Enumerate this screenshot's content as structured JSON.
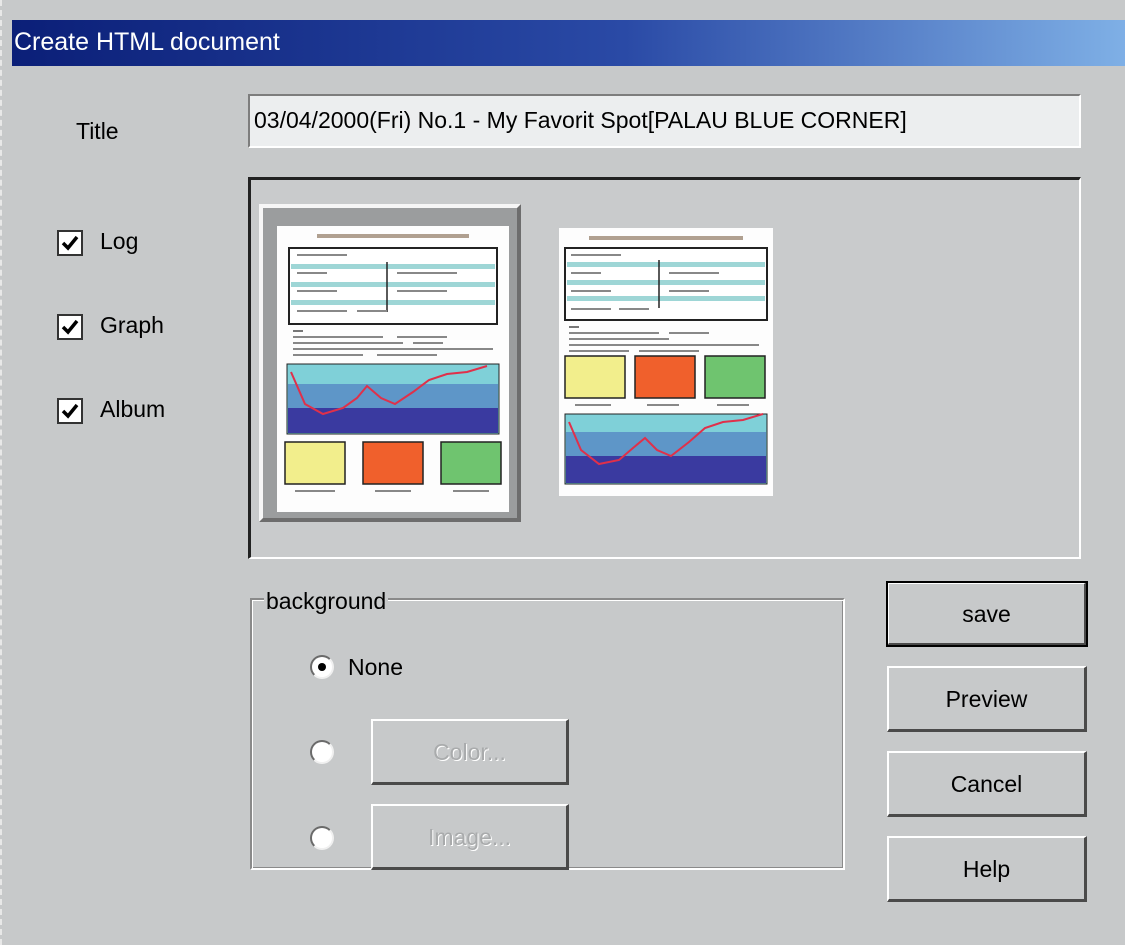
{
  "window": {
    "title": "Create HTML document"
  },
  "form": {
    "title_label": "Title",
    "title_value": "03/04/2000(Fri) No.1 - My Favorit Spot[PALAU BLUE CORNER]"
  },
  "checkboxes": [
    {
      "label": "Log",
      "checked": true
    },
    {
      "label": "Graph",
      "checked": true
    },
    {
      "label": "Album",
      "checked": true
    }
  ],
  "layouts": {
    "selected_index": 0,
    "colors": {
      "yellow": "#f2ee8c",
      "orange": "#f0602c",
      "green": "#6fc46f",
      "graph_top": "#7fd0d8",
      "graph_bottom": "#3a3aa0",
      "line": "#e0304a"
    }
  },
  "background": {
    "group_label": "background",
    "options": [
      {
        "label": "None",
        "selected": true
      },
      {
        "button": "Color...",
        "selected": false,
        "enabled": false
      },
      {
        "button": "Image...",
        "selected": false,
        "enabled": false
      }
    ]
  },
  "buttons": {
    "save": "save",
    "preview": "Preview",
    "cancel": "Cancel",
    "help": "Help"
  }
}
